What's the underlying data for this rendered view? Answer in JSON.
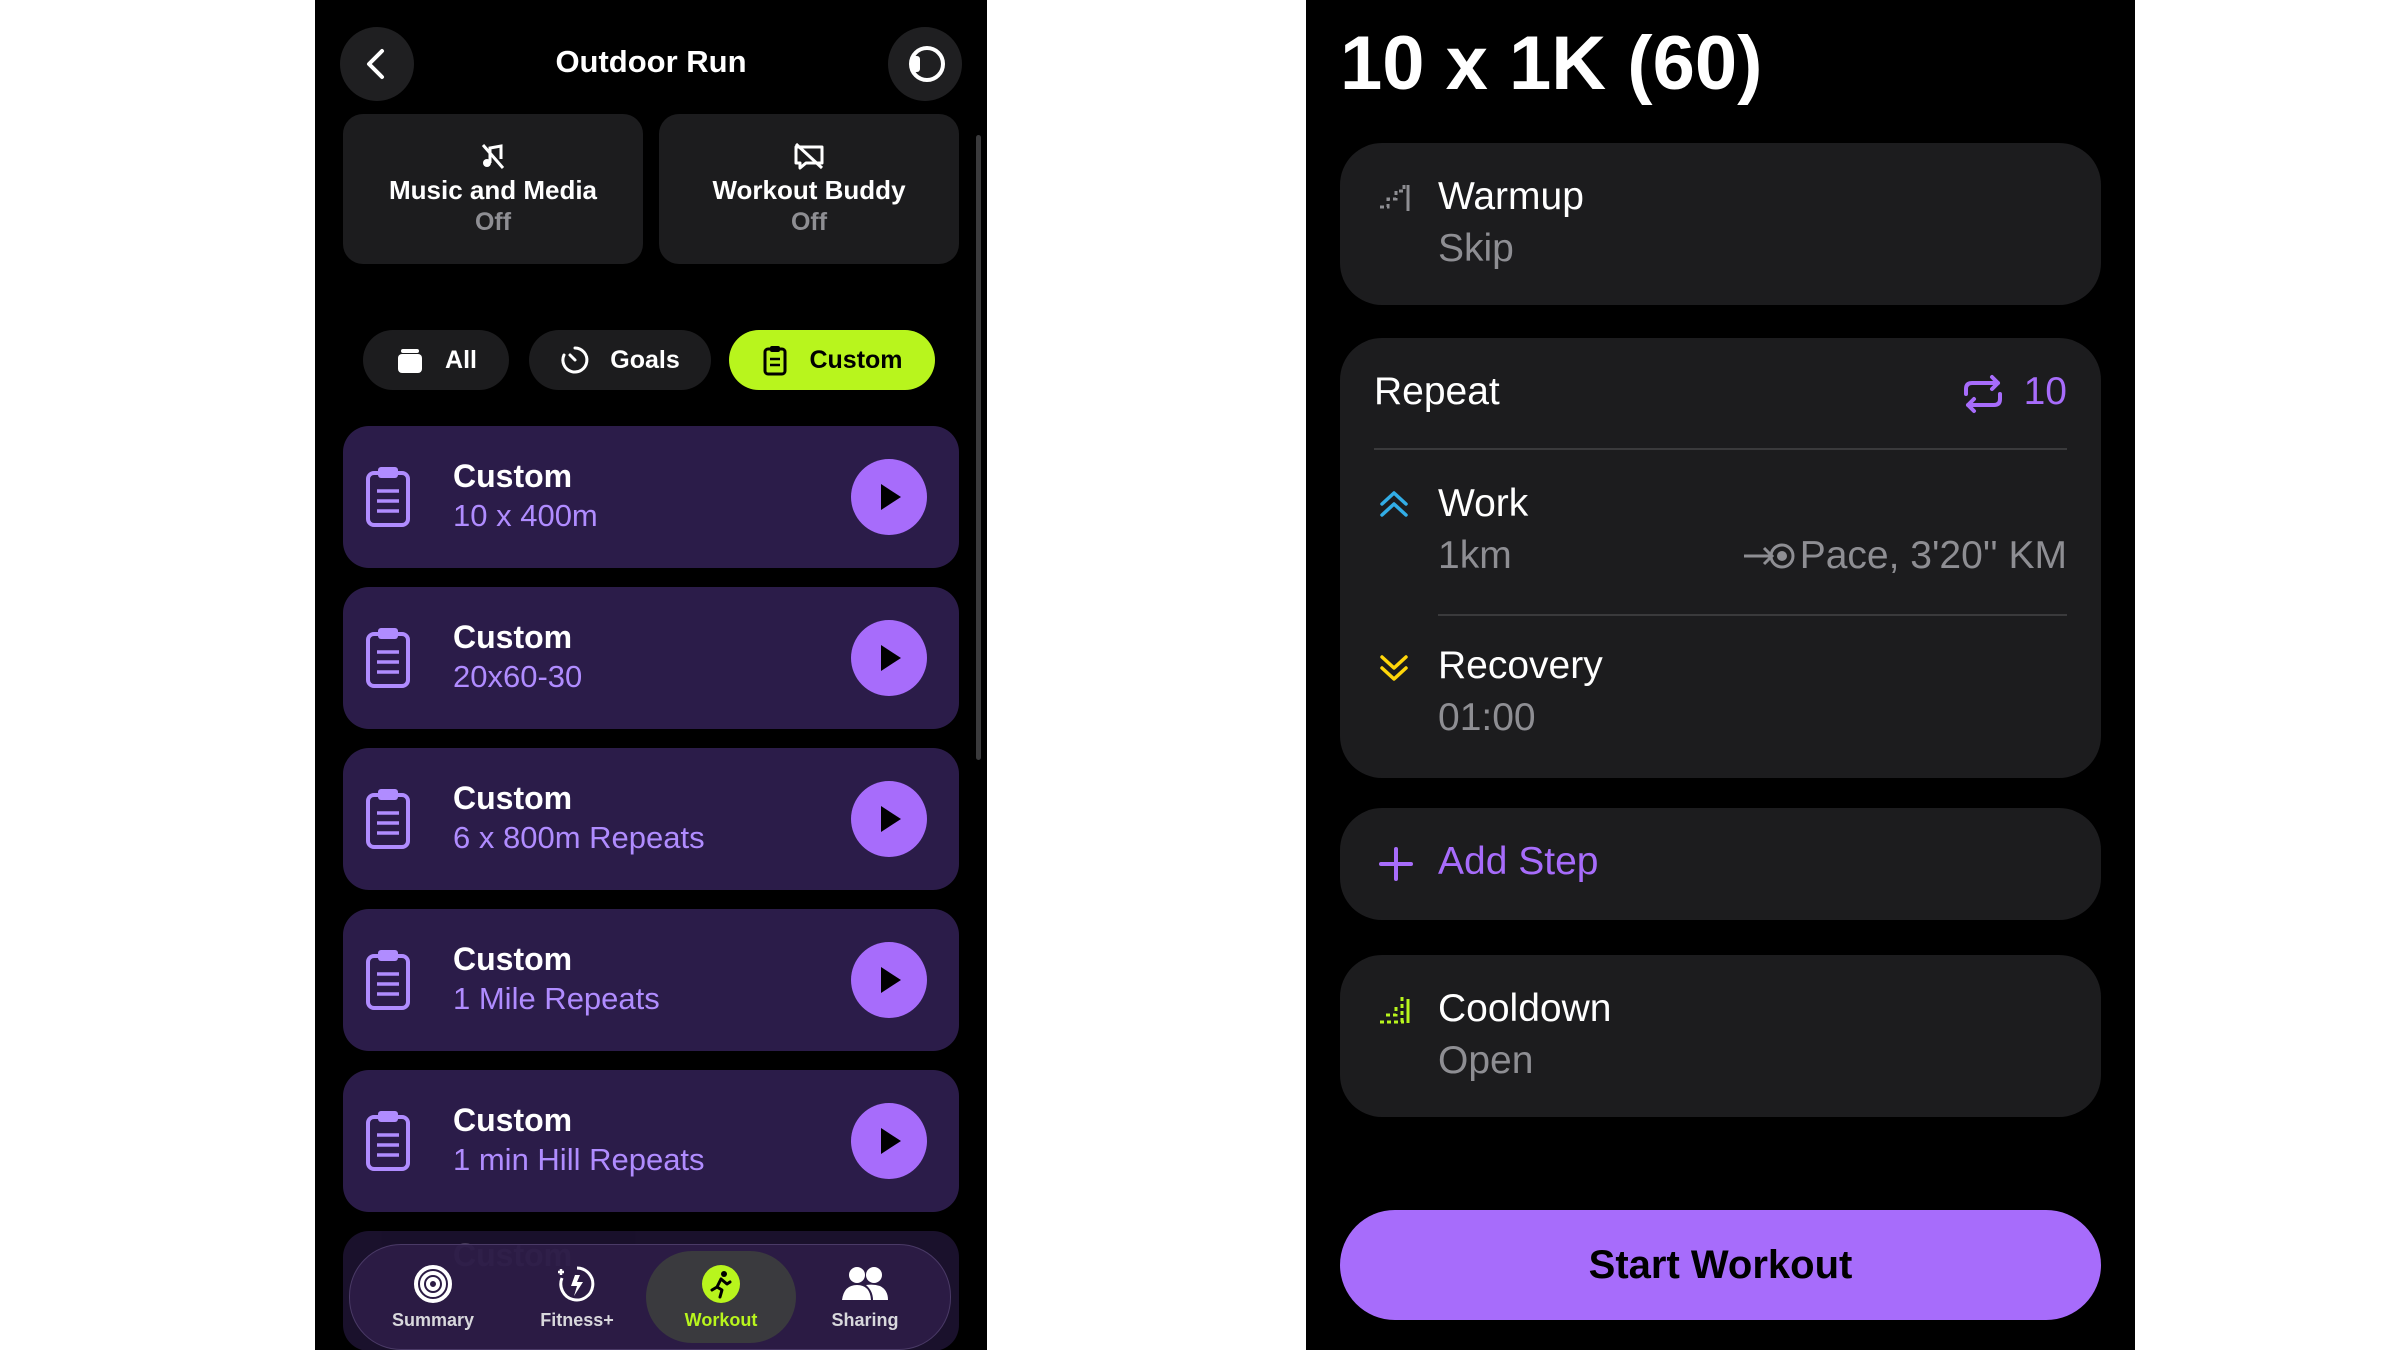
{
  "left": {
    "title": "Outdoor Run",
    "back_icon": "chevron-left-icon",
    "watch_icon": "watch-icon",
    "tiles": [
      {
        "label": "Music and Media",
        "value": "Off",
        "icon": "music-off-icon"
      },
      {
        "label": "Workout Buddy",
        "value": "Off",
        "icon": "buddy-off-icon"
      }
    ],
    "filters": [
      {
        "label": "All",
        "icon": "stack-icon",
        "active": false
      },
      {
        "label": "Goals",
        "icon": "goal-timer-icon",
        "active": false
      },
      {
        "label": "Custom",
        "icon": "clipboard-icon",
        "active": true
      }
    ],
    "workouts": [
      {
        "title": "Custom",
        "subtitle": "10 x 400m"
      },
      {
        "title": "Custom",
        "subtitle": "20x60-30"
      },
      {
        "title": "Custom",
        "subtitle": "6 x 800m Repeats"
      },
      {
        "title": "Custom",
        "subtitle": "1 Mile Repeats"
      },
      {
        "title": "Custom",
        "subtitle": "1 min Hill Repeats"
      }
    ],
    "partial_card_title": "Custom",
    "tabs": [
      {
        "label": "Summary",
        "icon": "activity-rings-icon",
        "active": false
      },
      {
        "label": "Fitness+",
        "icon": "fitness-plus-icon",
        "active": false
      },
      {
        "label": "Workout",
        "icon": "running-figure-icon",
        "active": true
      },
      {
        "label": "Sharing",
        "icon": "people-icon",
        "active": false
      }
    ],
    "colors": {
      "accent": "#b8f51d",
      "purple": "#a76cfb",
      "card": "#2b1c49"
    }
  },
  "right": {
    "title": "10 x 1K (60)",
    "warmup": {
      "name": "Warmup",
      "value": "Skip"
    },
    "repeat": {
      "label": "Repeat",
      "count": "10"
    },
    "work": {
      "name": "Work",
      "value": "1km",
      "alert": "Pace, 3'20'' KM"
    },
    "recovery": {
      "name": "Recovery",
      "value": "01:00"
    },
    "add_step": "Add Step",
    "cooldown": {
      "name": "Cooldown",
      "value": "Open"
    },
    "start_button": "Start Workout",
    "colors": {
      "work": "#32ade6",
      "recovery": "#ffd60a",
      "cooldown": "#b8f51d",
      "purple": "#a76cfb"
    }
  }
}
